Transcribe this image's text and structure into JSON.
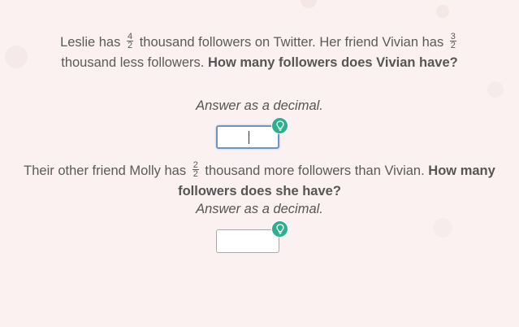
{
  "question1": {
    "text_before_frac1": "Leslie has",
    "frac1": {
      "numerator": "4",
      "denominator": "2"
    },
    "text_between": "thousand followers on Twitter. Her friend Vivian has",
    "frac2": {
      "numerator": "3",
      "denominator": "2"
    },
    "text_after": "thousand less followers.",
    "bold_question": "How many followers does Vivian have?",
    "hint": "Answer as a decimal.",
    "answer_value": ""
  },
  "question2": {
    "text_before_frac": "Their other friend Molly has",
    "frac": {
      "numerator": "2",
      "denominator": "2"
    },
    "text_after": "thousand more followers than Vivian.",
    "bold_question": "How many followers does she have?",
    "hint": "Answer as a decimal.",
    "answer_value": ""
  },
  "icons": {
    "hint_button": "lightbulb-icon"
  },
  "colors": {
    "background": "#fbf1f0",
    "text": "#5a5a5a",
    "hint_button": "#2bb08f",
    "focus_border": "#6d93c8"
  }
}
